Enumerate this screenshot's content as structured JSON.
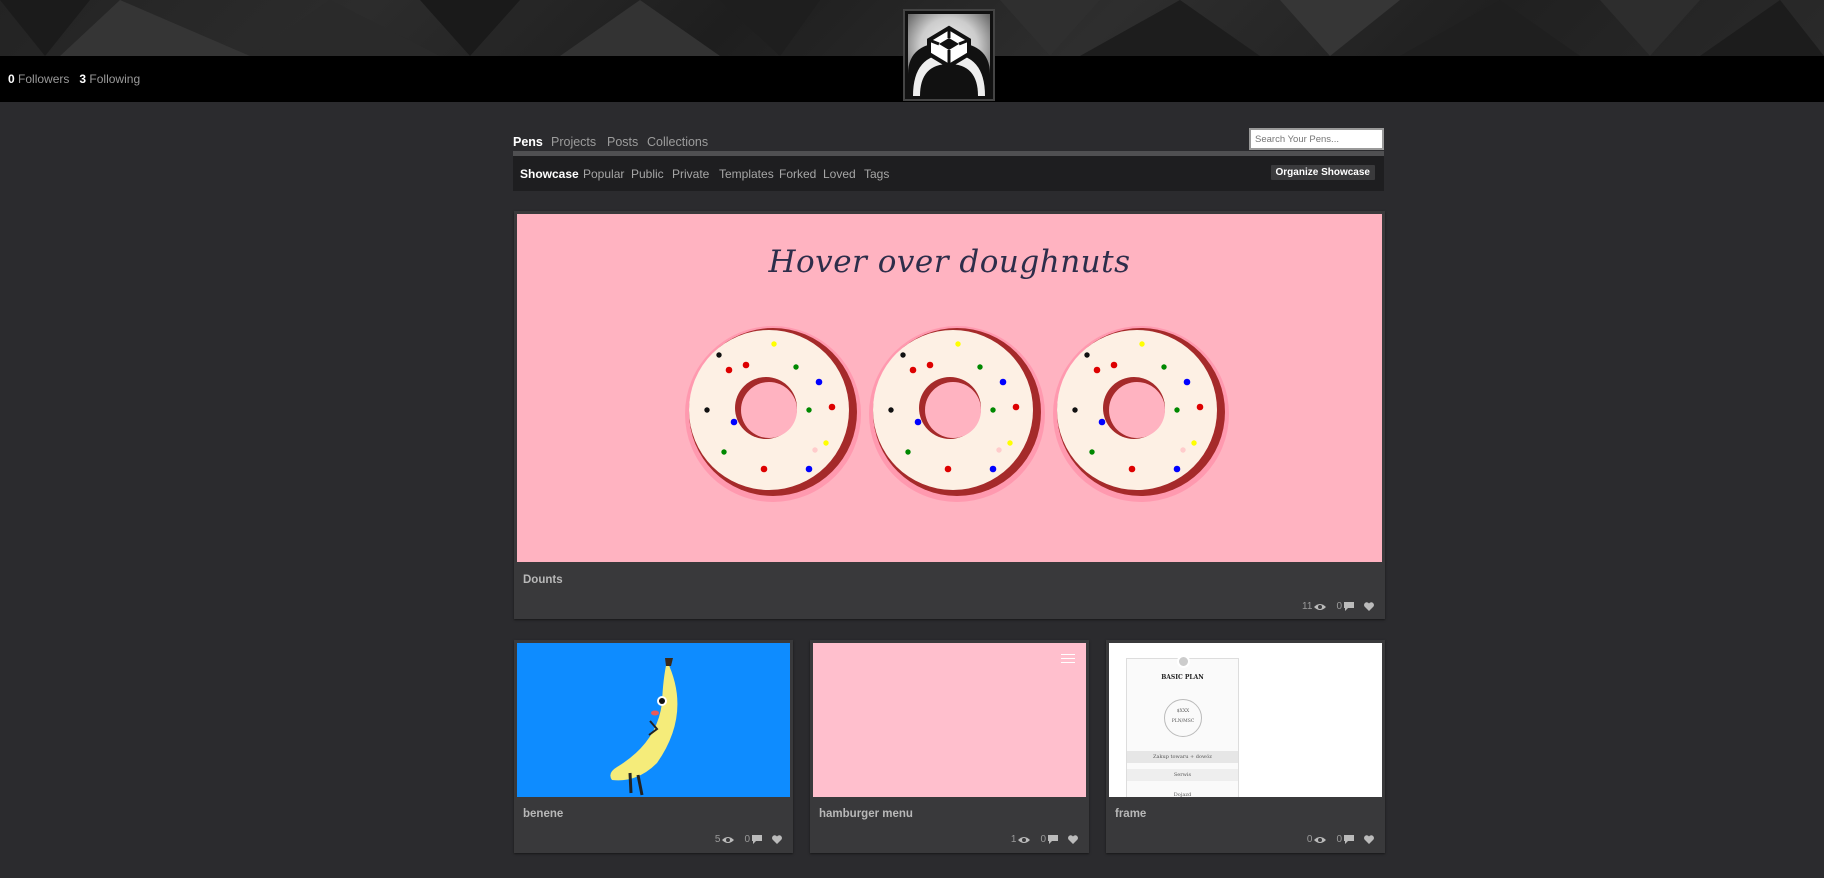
{
  "profile": {
    "followers_count": "0",
    "followers_label": "Followers",
    "following_count": "3",
    "following_label": "Following",
    "avatar_icon": "codepen-cube-icon"
  },
  "top_tabs": [
    "Pens",
    "Projects",
    "Posts",
    "Collections"
  ],
  "search": {
    "placeholder": "Search Your Pens..."
  },
  "sub_tabs": [
    "Showcase",
    "Popular",
    "Public",
    "Private",
    "Templates",
    "Forked",
    "Loved",
    "Tags"
  ],
  "organize_button": "Organize Showcase",
  "featured": {
    "title": "Dounts",
    "preview_heading": "Hover over doughnuts",
    "views": "11",
    "comments": "0",
    "colors": {
      "background": "#ffb3c1",
      "donut_rim": "#a52a2a",
      "icing": "#fdf0e4"
    }
  },
  "pens": [
    {
      "title": "benene",
      "views": "5",
      "comments": "0"
    },
    {
      "title": "hamburger menu",
      "views": "1",
      "comments": "0"
    },
    {
      "title": "frame",
      "views": "0",
      "comments": "0",
      "preview": {
        "heading": "BASIC PLAN",
        "circle_line1": "$XXX",
        "circle_line2": "PLN/MSC",
        "rows": [
          "Zakup towaru + dowóz",
          "Serwis",
          "Dojazd"
        ]
      }
    }
  ],
  "icons": {
    "views": "eye-icon",
    "comments": "comment-icon",
    "love": "heart-icon"
  }
}
